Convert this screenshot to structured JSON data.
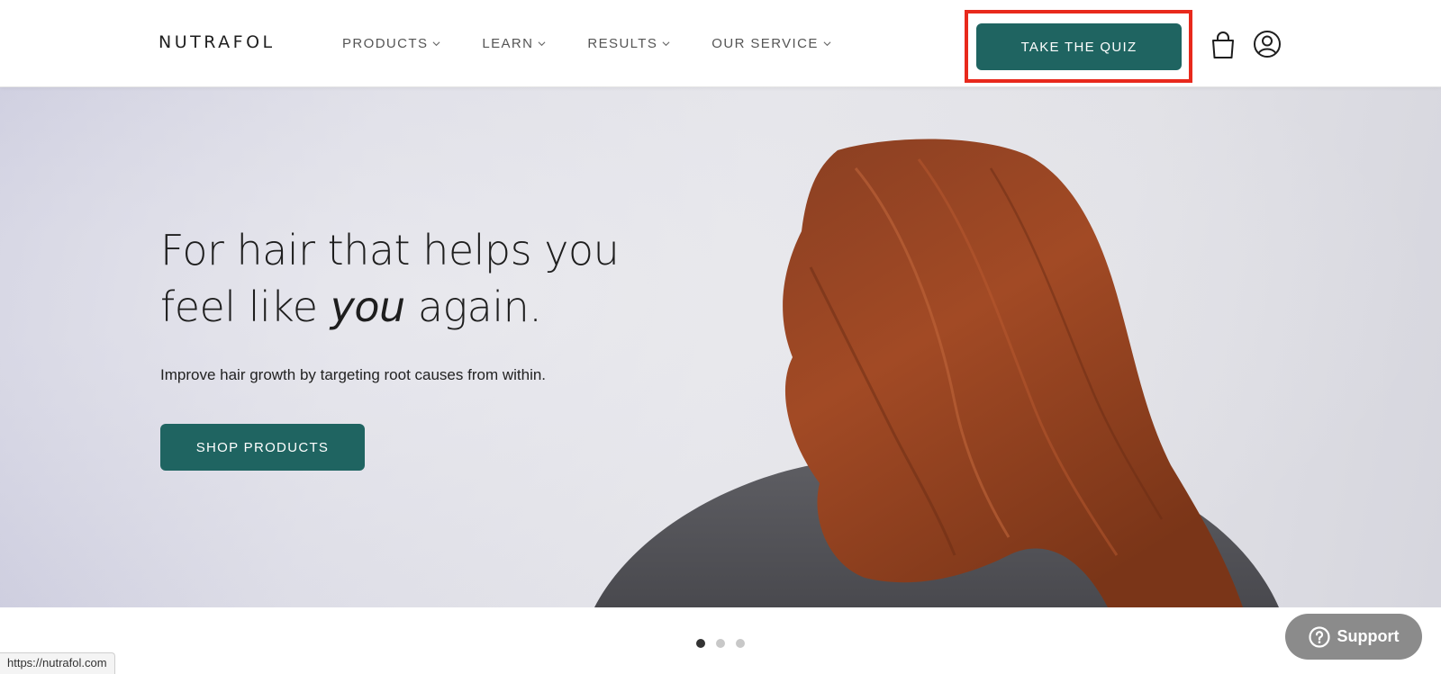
{
  "header": {
    "logo": "NUTRAFOL",
    "nav": [
      {
        "label": "PRODUCTS"
      },
      {
        "label": "LEARN"
      },
      {
        "label": "RESULTS"
      },
      {
        "label": "OUR SERVICE"
      }
    ],
    "quiz_label": "TAKE THE QUIZ"
  },
  "hero": {
    "headline_line1": "For hair that helps you",
    "headline_pre": "feel like ",
    "headline_em": "you",
    "headline_post": " again.",
    "subhead": "Improve hair growth by targeting root causes from within.",
    "cta_label": "SHOP PRODUCTS"
  },
  "carousel": {
    "total": 3,
    "active": 1
  },
  "support_label": "Support",
  "status_url": "https://nutrafol.com",
  "colors": {
    "brand_green": "#1f6461",
    "highlight_red": "#e8291c",
    "support_gray": "#8b8b8b"
  },
  "icons": {
    "bag": "shopping-bag-icon",
    "account": "user-circle-icon",
    "help": "question-circle-icon",
    "chevron": "chevron-down-icon"
  }
}
